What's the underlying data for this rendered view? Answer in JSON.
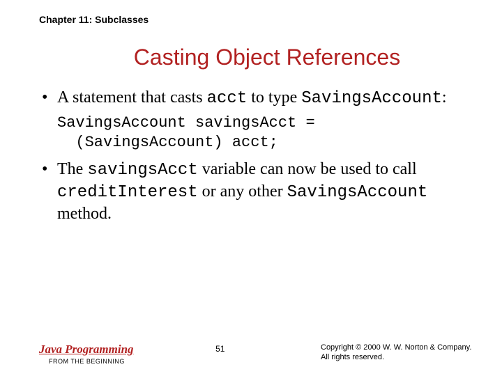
{
  "chapter": "Chapter 11: Subclasses",
  "title": "Casting Object References",
  "bullet1_a": "A statement that casts ",
  "bullet1_code1": "acct",
  "bullet1_b": " to type ",
  "bullet1_code2": "SavingsAccount",
  "bullet1_c": ":",
  "codeblock": "SavingsAccount savingsAcct =\n  (SavingsAccount) acct;",
  "bullet2_a": "The ",
  "bullet2_code1": "savingsAcct",
  "bullet2_b": " variable can now be used to call ",
  "bullet2_code2": "creditInterest",
  "bullet2_c": " or any other ",
  "bullet2_code3": "SavingsAccount",
  "bullet2_d": " method.",
  "footer": {
    "brand": "Java Programming",
    "tagline": "FROM THE BEGINNING",
    "page": "51",
    "copyright1": "Copyright © 2000 W. W. Norton & Company.",
    "copyright2": "All rights reserved."
  }
}
